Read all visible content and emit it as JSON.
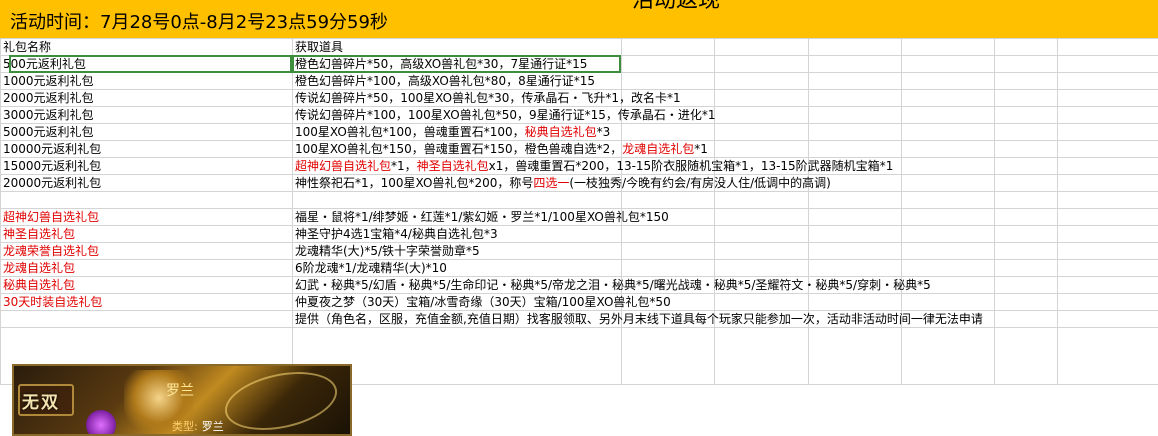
{
  "banner": {
    "title": "活动返现",
    "time": "活动时间：7月28号0点-8月2号23点59分59秒",
    "bg_color": "#ffc000"
  },
  "header": {
    "col_name": "礼包名称",
    "col_reward": "获取道具"
  },
  "rows": [
    {
      "name": "500元返利礼包",
      "reward": "橙色幻兽碎片*50，高级XO兽礼包*30，7星通行证*15"
    },
    {
      "name": "1000元返利礼包",
      "reward": "橙色幻兽碎片*100，高级XO兽礼包*80，8星通行证*15"
    },
    {
      "name": "2000元返利礼包",
      "reward": "传说幻兽碎片*50，100星XO兽礼包*30，传承晶石・飞升*1，改名卡*1"
    },
    {
      "name": "3000元返利礼包",
      "reward": "传说幻兽碎片*100，100星XO兽礼包*50，9星通行证*15，传承晶石・进化*1"
    },
    {
      "name": "5000元返利礼包",
      "reward_a": "100星XO兽礼包*100，兽魂重置石*100，",
      "reward_red": "秘典自选礼包",
      "reward_b": "*3"
    },
    {
      "name": "10000元返利礼包",
      "reward_a": "100星XO兽礼包*150，兽魂重置石*150，橙色兽魂自选*2，",
      "reward_red": "龙魂自选礼包",
      "reward_b": "*1"
    },
    {
      "name": "15000元返利礼包",
      "reward_red": "超神幻兽自选礼包",
      "reward_a": "*1，",
      "reward_red2": "神圣自选礼包",
      "reward_b": "x1，兽魂重置石*200，13-15阶衣服随机宝箱*1，13-15阶武器随机宝箱*1"
    },
    {
      "name": "20000元返利礼包",
      "reward_a": "神性祭祀石*1，100星XO兽礼包*200，称号",
      "reward_red": "四选一",
      "reward_b": "(一枝独秀/今晚有约会/有房没人住/低调中的高调)"
    },
    {
      "name": "",
      "reward": ""
    },
    {
      "name": "超神幻兽自选礼包",
      "reward": "福星・鼠将*1/绯梦姬・红莲*1/紫幻姬・罗兰*1/100星XO兽礼包*150"
    },
    {
      "name": "神圣自选礼包",
      "reward": "神圣守护4选1宝箱*4/秘典自选礼包*3"
    },
    {
      "name": "龙魂荣誉自选礼包",
      "reward": "龙魂精华(大)*5/铁十字荣誉勋章*5"
    },
    {
      "name": "龙魂自选礼包",
      "reward": "6阶龙魂*1/龙魂精华(大)*10"
    },
    {
      "name": "秘典自选礼包",
      "reward": "幻武・秘典*5/幻盾・秘典*5/生命印记・秘典*5/帝龙之泪・秘典*5/曙光战魂・秘典*5/圣耀符文・秘典*5/穿刺・秘典*5"
    },
    {
      "name": "30天时装自选礼包",
      "reward": "仲夏夜之梦（30天）宝箱/冰雪奇缘（30天）宝箱/100星XO兽礼包*50"
    },
    {
      "name": "",
      "reward": "提供（角色名，区服，充值金额,充值日期）找客服领取、另外月末线下道具每个玩家只能参加一次，活动非活动时间一律无法申请"
    }
  ],
  "image": {
    "badge": "无双",
    "char_name": "罗兰",
    "type_label": "类型:",
    "type_value": "罗兰"
  },
  "colors": {
    "red_text": "#e00000",
    "selection": "#3d8e3d"
  }
}
